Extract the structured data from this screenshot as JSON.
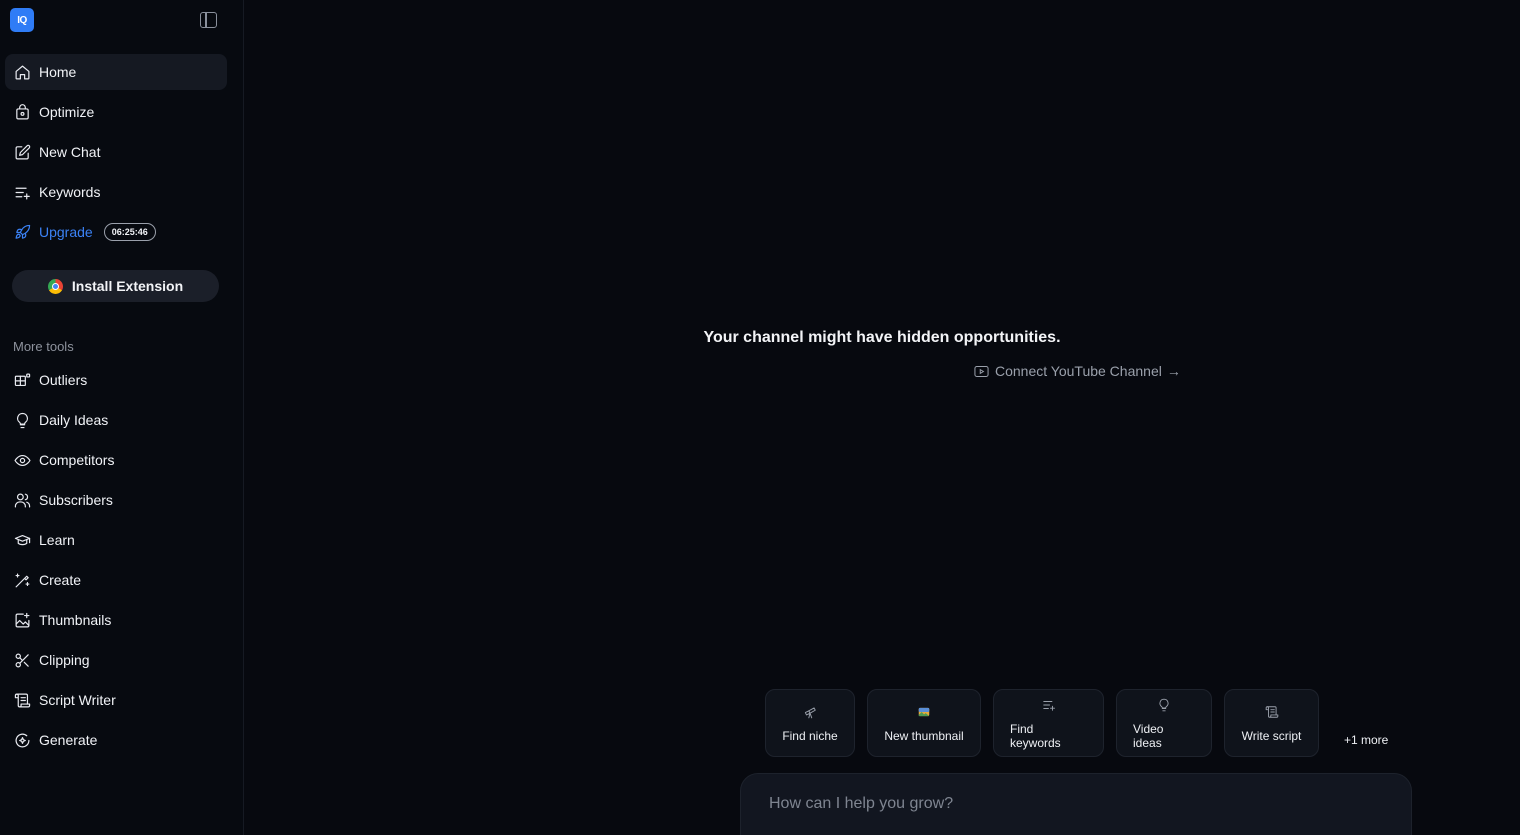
{
  "app": {
    "logo_text": "IQ",
    "colors": {
      "accent": "#3b82f6",
      "background": "#07090f",
      "sidebar_active": "#151922"
    }
  },
  "sidebar": {
    "nav": [
      {
        "label": "Home",
        "icon": "home-icon"
      },
      {
        "label": "Optimize",
        "icon": "bag-icon"
      },
      {
        "label": "New Chat",
        "icon": "edit-icon"
      },
      {
        "label": "Keywords",
        "icon": "list-plus-icon"
      }
    ],
    "upgrade": {
      "label": "Upgrade",
      "timer": "06:25:46",
      "icon": "rocket-icon"
    },
    "install_extension": "Install Extension",
    "more_tools_label": "More tools",
    "tools": [
      {
        "label": "Outliers",
        "icon": "outliers-icon"
      },
      {
        "label": "Daily Ideas",
        "icon": "lightbulb-icon"
      },
      {
        "label": "Competitors",
        "icon": "eye-icon"
      },
      {
        "label": "Subscribers",
        "icon": "users-icon"
      },
      {
        "label": "Learn",
        "icon": "graduation-cap-icon"
      },
      {
        "label": "Create",
        "icon": "magic-pen-icon"
      },
      {
        "label": "Thumbnails",
        "icon": "image-icon"
      },
      {
        "label": "Clipping",
        "icon": "scissors-icon"
      },
      {
        "label": "Script Writer",
        "icon": "scroll-icon"
      },
      {
        "label": "Generate",
        "icon": "sparkle-circle-icon"
      }
    ]
  },
  "main": {
    "hero_title": "Your channel might have hidden opportunities.",
    "connect_label": "Connect YouTube Channel",
    "connect_arrow": "→",
    "chips": [
      {
        "label": "Find niche",
        "icon": "telescope-icon"
      },
      {
        "label": "New thumbnail",
        "icon": "picture-icon"
      },
      {
        "label": "Find keywords",
        "icon": "list-plus-icon"
      },
      {
        "label": "Video ideas",
        "icon": "lightbulb-icon"
      },
      {
        "label": "Write script",
        "icon": "scroll-icon"
      }
    ],
    "more_label": "+1 more",
    "chat_placeholder": "How can I help you grow?"
  }
}
